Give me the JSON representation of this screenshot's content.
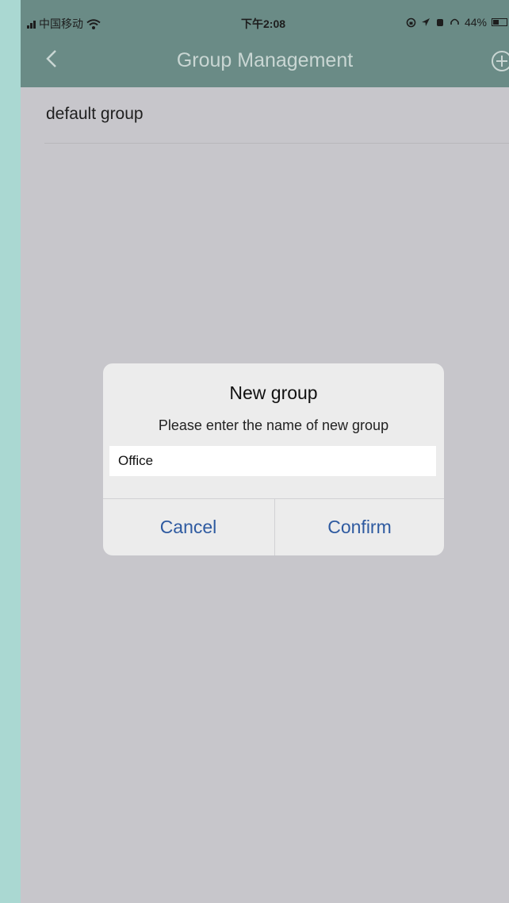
{
  "status_bar": {
    "carrier": "中国移动",
    "time": "下午2:08",
    "battery": "44%",
    "battery_level": 0.44
  },
  "nav": {
    "title": "Group Management",
    "back_icon": "chevron-left-icon",
    "add_icon": "plus-circle-icon"
  },
  "groups": [
    {
      "name": "default group"
    }
  ],
  "dialog": {
    "title": "New group",
    "message": "Please enter the name of new group",
    "input_value": "Office",
    "cancel_label": "Cancel",
    "confirm_label": "Confirm"
  },
  "colors": {
    "nav_bg": "#6a8b86",
    "page_bg": "#c7c6cb",
    "outer_bg": "#aad8d2",
    "dialog_button": "#2e5aa0"
  }
}
